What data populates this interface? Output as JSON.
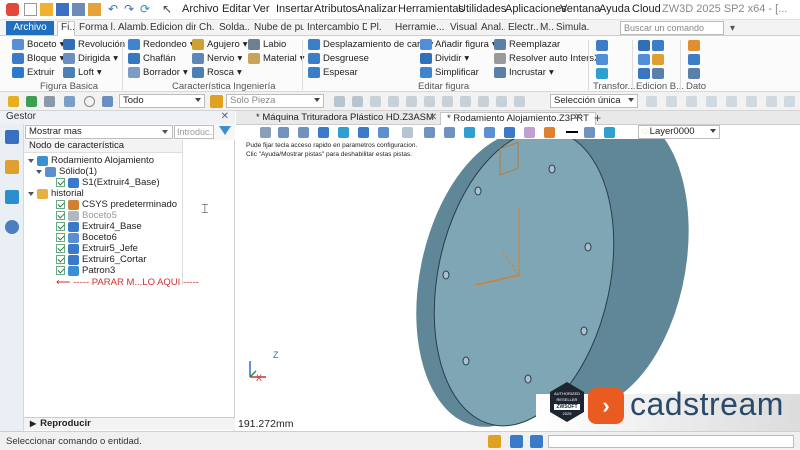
{
  "app": {
    "window_title": "ZW3D 2025 SP2 x64 - [..."
  },
  "menu": [
    "Archivo",
    "Editar",
    "Ver",
    "Insertar",
    "Atributos",
    "Analizar",
    "Herramientas",
    "Utilidades",
    "Aplicaciones",
    "Ventana",
    "Ayuda",
    "Cloud"
  ],
  "ribbon_tabs": {
    "archivo": "Archivo",
    "items": [
      "Fi...",
      "Forma l...",
      "Alamb...",
      "Edicion dir...",
      "Ch...",
      "Solda...",
      "Nube de pu...",
      "Intercambio D...",
      "Pl...",
      "Herramie...",
      "Visual...",
      "Anal...",
      "Electr...",
      "M...",
      "Simula..."
    ]
  },
  "search": {
    "placeholder": "Buscar un comando"
  },
  "ribbon": {
    "figura_basica": {
      "label": "Figura Basica",
      "items": [
        "Boceto",
        "Revolución",
        "Bloque",
        "Dirigida",
        "Extruir",
        "Loft"
      ]
    },
    "caracteristica": {
      "label": "Característica Ingeniería",
      "items": [
        "Redondeo",
        "Agujero",
        "Labio",
        "Chaflán",
        "Nervio",
        "Material",
        "Borrador",
        "Rosca"
      ]
    },
    "editar_figura": {
      "label": "Editar figura",
      "items": [
        "Desplazamiento de cara",
        "Añadir figura",
        "Reemplazar",
        "Desgruese",
        "Dividir",
        "Resolver auto IntersX",
        "Espesar",
        "Simplificar",
        "Incrustar"
      ]
    },
    "transfor": {
      "label": "Transfor..."
    },
    "edicion_b": {
      "label": "Edicion B..."
    },
    "dato": {
      "label": "Dato"
    }
  },
  "toolbar": {
    "filter": "Todo",
    "mode": "Solo Pieza",
    "selection": "Selección única"
  },
  "panel": {
    "title": "Gestor",
    "filter_value": "Mostrar mas",
    "filter_placeholder": "Introduc...",
    "tree_header": "Nodo de característica",
    "tree": {
      "root": "Rodamiento Alojamiento",
      "solid": "Sólido(1)",
      "solid_child": "S1(Extruir4_Base)",
      "history": "historial",
      "items": [
        "CSYS predeterminado",
        "Boceto5",
        "Extruir4_Base",
        "Boceto6",
        "Extruir5_Jefe",
        "Extruir6_Cortar",
        "Patron3"
      ],
      "stop": "----- PARAR M...LO AQUI -----"
    },
    "reproducir": "Reproducir"
  },
  "doc_tabs": [
    "* Máquina Trituradora Plástico HD.Z3ASM",
    "* Rodamiento Alojamiento.Z3PRT"
  ],
  "view": {
    "layer": "Layer0000",
    "hint_line1": "Pude fijar tecla acceso rapido en parametros configuracion.",
    "hint_line2": "Clic \"Ayuda/Mostrar pistas\" para deshabilitar estas pistas.",
    "measurement": "191.272mm",
    "axis_z": "Z",
    "axis_x": "X"
  },
  "status": {
    "text": "Seleccionar comando o entidad."
  },
  "brand": {
    "name": "cadstream",
    "badge_top": "AUTHORIZED RESELLER",
    "badge_mid": "ZWSOFT",
    "badge_year": "2025"
  },
  "colors": {
    "accent": "#1f6fbf",
    "brand_orange": "#ea5b22",
    "part_face": "#7fa6b5",
    "part_rim": "#5f8797"
  }
}
